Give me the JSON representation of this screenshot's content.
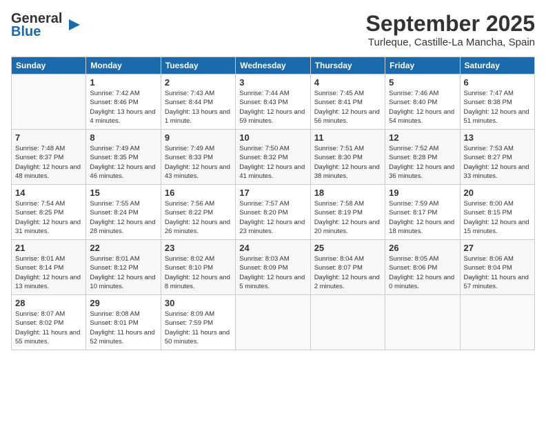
{
  "header": {
    "logo_general": "General",
    "logo_blue": "Blue",
    "month": "September 2025",
    "location": "Turleque, Castille-La Mancha, Spain"
  },
  "weekdays": [
    "Sunday",
    "Monday",
    "Tuesday",
    "Wednesday",
    "Thursday",
    "Friday",
    "Saturday"
  ],
  "weeks": [
    [
      {
        "day": "",
        "sunrise": "",
        "sunset": "",
        "daylight": ""
      },
      {
        "day": "1",
        "sunrise": "Sunrise: 7:42 AM",
        "sunset": "Sunset: 8:46 PM",
        "daylight": "Daylight: 13 hours and 4 minutes."
      },
      {
        "day": "2",
        "sunrise": "Sunrise: 7:43 AM",
        "sunset": "Sunset: 8:44 PM",
        "daylight": "Daylight: 13 hours and 1 minute."
      },
      {
        "day": "3",
        "sunrise": "Sunrise: 7:44 AM",
        "sunset": "Sunset: 8:43 PM",
        "daylight": "Daylight: 12 hours and 59 minutes."
      },
      {
        "day": "4",
        "sunrise": "Sunrise: 7:45 AM",
        "sunset": "Sunset: 8:41 PM",
        "daylight": "Daylight: 12 hours and 56 minutes."
      },
      {
        "day": "5",
        "sunrise": "Sunrise: 7:46 AM",
        "sunset": "Sunset: 8:40 PM",
        "daylight": "Daylight: 12 hours and 54 minutes."
      },
      {
        "day": "6",
        "sunrise": "Sunrise: 7:47 AM",
        "sunset": "Sunset: 8:38 PM",
        "daylight": "Daylight: 12 hours and 51 minutes."
      }
    ],
    [
      {
        "day": "7",
        "sunrise": "Sunrise: 7:48 AM",
        "sunset": "Sunset: 8:37 PM",
        "daylight": "Daylight: 12 hours and 48 minutes."
      },
      {
        "day": "8",
        "sunrise": "Sunrise: 7:49 AM",
        "sunset": "Sunset: 8:35 PM",
        "daylight": "Daylight: 12 hours and 46 minutes."
      },
      {
        "day": "9",
        "sunrise": "Sunrise: 7:49 AM",
        "sunset": "Sunset: 8:33 PM",
        "daylight": "Daylight: 12 hours and 43 minutes."
      },
      {
        "day": "10",
        "sunrise": "Sunrise: 7:50 AM",
        "sunset": "Sunset: 8:32 PM",
        "daylight": "Daylight: 12 hours and 41 minutes."
      },
      {
        "day": "11",
        "sunrise": "Sunrise: 7:51 AM",
        "sunset": "Sunset: 8:30 PM",
        "daylight": "Daylight: 12 hours and 38 minutes."
      },
      {
        "day": "12",
        "sunrise": "Sunrise: 7:52 AM",
        "sunset": "Sunset: 8:28 PM",
        "daylight": "Daylight: 12 hours and 36 minutes."
      },
      {
        "day": "13",
        "sunrise": "Sunrise: 7:53 AM",
        "sunset": "Sunset: 8:27 PM",
        "daylight": "Daylight: 12 hours and 33 minutes."
      }
    ],
    [
      {
        "day": "14",
        "sunrise": "Sunrise: 7:54 AM",
        "sunset": "Sunset: 8:25 PM",
        "daylight": "Daylight: 12 hours and 31 minutes."
      },
      {
        "day": "15",
        "sunrise": "Sunrise: 7:55 AM",
        "sunset": "Sunset: 8:24 PM",
        "daylight": "Daylight: 12 hours and 28 minutes."
      },
      {
        "day": "16",
        "sunrise": "Sunrise: 7:56 AM",
        "sunset": "Sunset: 8:22 PM",
        "daylight": "Daylight: 12 hours and 26 minutes."
      },
      {
        "day": "17",
        "sunrise": "Sunrise: 7:57 AM",
        "sunset": "Sunset: 8:20 PM",
        "daylight": "Daylight: 12 hours and 23 minutes."
      },
      {
        "day": "18",
        "sunrise": "Sunrise: 7:58 AM",
        "sunset": "Sunset: 8:19 PM",
        "daylight": "Daylight: 12 hours and 20 minutes."
      },
      {
        "day": "19",
        "sunrise": "Sunrise: 7:59 AM",
        "sunset": "Sunset: 8:17 PM",
        "daylight": "Daylight: 12 hours and 18 minutes."
      },
      {
        "day": "20",
        "sunrise": "Sunrise: 8:00 AM",
        "sunset": "Sunset: 8:15 PM",
        "daylight": "Daylight: 12 hours and 15 minutes."
      }
    ],
    [
      {
        "day": "21",
        "sunrise": "Sunrise: 8:01 AM",
        "sunset": "Sunset: 8:14 PM",
        "daylight": "Daylight: 12 hours and 13 minutes."
      },
      {
        "day": "22",
        "sunrise": "Sunrise: 8:01 AM",
        "sunset": "Sunset: 8:12 PM",
        "daylight": "Daylight: 12 hours and 10 minutes."
      },
      {
        "day": "23",
        "sunrise": "Sunrise: 8:02 AM",
        "sunset": "Sunset: 8:10 PM",
        "daylight": "Daylight: 12 hours and 8 minutes."
      },
      {
        "day": "24",
        "sunrise": "Sunrise: 8:03 AM",
        "sunset": "Sunset: 8:09 PM",
        "daylight": "Daylight: 12 hours and 5 minutes."
      },
      {
        "day": "25",
        "sunrise": "Sunrise: 8:04 AM",
        "sunset": "Sunset: 8:07 PM",
        "daylight": "Daylight: 12 hours and 2 minutes."
      },
      {
        "day": "26",
        "sunrise": "Sunrise: 8:05 AM",
        "sunset": "Sunset: 8:06 PM",
        "daylight": "Daylight: 12 hours and 0 minutes."
      },
      {
        "day": "27",
        "sunrise": "Sunrise: 8:06 AM",
        "sunset": "Sunset: 8:04 PM",
        "daylight": "Daylight: 11 hours and 57 minutes."
      }
    ],
    [
      {
        "day": "28",
        "sunrise": "Sunrise: 8:07 AM",
        "sunset": "Sunset: 8:02 PM",
        "daylight": "Daylight: 11 hours and 55 minutes."
      },
      {
        "day": "29",
        "sunrise": "Sunrise: 8:08 AM",
        "sunset": "Sunset: 8:01 PM",
        "daylight": "Daylight: 11 hours and 52 minutes."
      },
      {
        "day": "30",
        "sunrise": "Sunrise: 8:09 AM",
        "sunset": "Sunset: 7:59 PM",
        "daylight": "Daylight: 11 hours and 50 minutes."
      },
      {
        "day": "",
        "sunrise": "",
        "sunset": "",
        "daylight": ""
      },
      {
        "day": "",
        "sunrise": "",
        "sunset": "",
        "daylight": ""
      },
      {
        "day": "",
        "sunrise": "",
        "sunset": "",
        "daylight": ""
      },
      {
        "day": "",
        "sunrise": "",
        "sunset": "",
        "daylight": ""
      }
    ]
  ]
}
